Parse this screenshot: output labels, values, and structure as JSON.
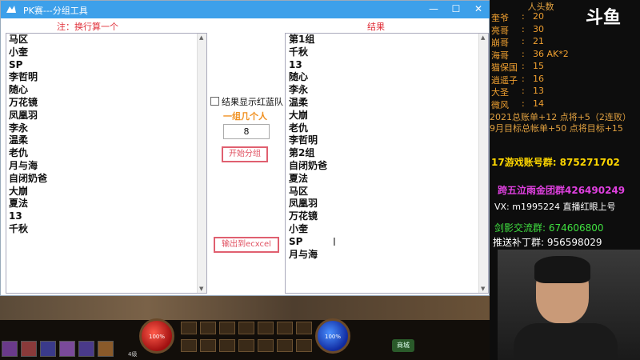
{
  "window": {
    "title": "PK赛---分组工具",
    "left_header": "注：换行算一个",
    "right_header": "结果",
    "left_list": [
      "马区",
      "小奎",
      "SP",
      "李哲明",
      "随心",
      "万花镜",
      "凤凰羽",
      "李永",
      "温柔",
      "老仇",
      "月与海",
      "自闭奶爸",
      "大崩",
      "夏法",
      "13",
      "千秋"
    ],
    "right_list": [
      "第1组",
      "千秋",
      "13",
      "随心",
      "李永",
      "温柔",
      "大崩",
      "老仇",
      "李哲明",
      "第2组",
      "自闭奶爸",
      "夏法",
      "马区",
      "凤凰羽",
      "万花镜",
      "小奎",
      "SP",
      "月与海"
    ],
    "checkbox_label": "结果显示红蓝队",
    "group_size_label": "一组几个人",
    "group_size_value": "8",
    "start_button": "开始分组",
    "export_button": "输出到ecxcel",
    "controls": {
      "minimize": "—",
      "maximize": "☐",
      "close": "✕"
    }
  },
  "game_hud": {
    "hp_text": "100%",
    "mp_text": "100%",
    "level_text": "4级",
    "mall_button": "商城"
  },
  "stream_panel": {
    "logo": "斗鱼",
    "heads_title": "人头数",
    "scores": [
      {
        "name": "奎爷",
        "value": "20"
      },
      {
        "name": "亮哥",
        "value": "30"
      },
      {
        "name": "崩哥",
        "value": "21"
      },
      {
        "name": "海哥",
        "value": "36 AK*2"
      },
      {
        "name": "猫保国",
        "value": "15"
      },
      {
        "name": "逍遥子",
        "value": "16"
      },
      {
        "name": "大圣",
        "value": "13"
      },
      {
        "name": "微风",
        "value": "14"
      }
    ],
    "line1": "2021总账单+12 点将+5（2连败）",
    "line2": "9月目标总帐单+50 点将目标+15",
    "group1": "17游戏账号群: 875271702",
    "group2": "跨五泣雨金团群426490249",
    "vx": "VX: m1995224  直播红眼上号",
    "sword_group": "剑影交流群: 674606800",
    "push_group": "推送补丁群: 956598029"
  }
}
